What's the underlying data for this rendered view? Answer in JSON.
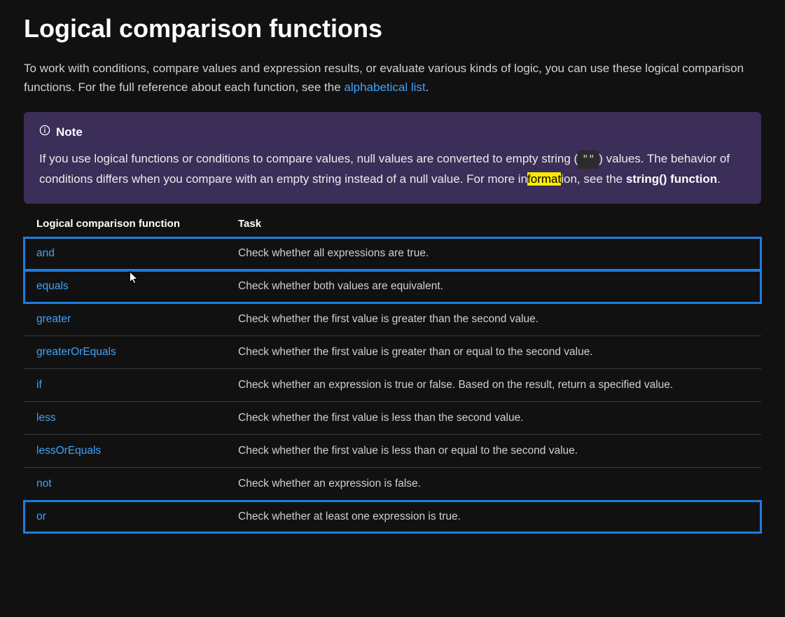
{
  "heading": "Logical comparison functions",
  "intro_before_link": "To work with conditions, compare values and expression results, or evaluate various kinds of logic, you can use these logical comparison functions. For the full reference about each function, see the ",
  "intro_link": "alphabetical list",
  "intro_after_link": ".",
  "note": {
    "title": "Note",
    "body_1": "If you use logical functions or conditions to compare values, null values are converted to empty string (",
    "code": "\"\"",
    "body_2": ") values. The behavior of conditions differs when you compare with an empty string instead of a null value. For more in",
    "highlight": "format",
    "body_3": "ion, see the ",
    "bold_link": "string() function",
    "body_4": "."
  },
  "table": {
    "col1": "Logical comparison function",
    "col2": "Task",
    "rows": [
      {
        "fn": "and",
        "task": "Check whether all expressions are true.",
        "boxed": true
      },
      {
        "fn": "equals",
        "task": "Check whether both values are equivalent.",
        "boxed": true
      },
      {
        "fn": "greater",
        "task": "Check whether the first value is greater than the second value.",
        "boxed": false
      },
      {
        "fn": "greaterOrEquals",
        "task": "Check whether the first value is greater than or equal to the second value.",
        "boxed": false
      },
      {
        "fn": "if",
        "task": "Check whether an expression is true or false. Based on the result, return a specified value.",
        "boxed": false
      },
      {
        "fn": "less",
        "task": "Check whether the first value is less than the second value.",
        "boxed": false
      },
      {
        "fn": "lessOrEquals",
        "task": "Check whether the first value is less than or equal to the second value.",
        "boxed": false
      },
      {
        "fn": "not",
        "task": "Check whether an expression is false.",
        "boxed": false
      },
      {
        "fn": "or",
        "task": "Check whether at least one expression is true.",
        "boxed": true
      }
    ]
  }
}
